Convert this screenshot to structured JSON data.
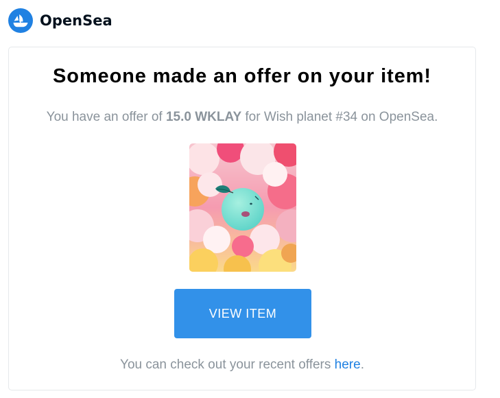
{
  "header": {
    "brand_name": "OpenSea",
    "logo_icon": "opensea-logo-icon",
    "logo_color": "#2081e2"
  },
  "card": {
    "title": "Someone made an offer on your item!",
    "subtitle_prefix": "You have an offer of ",
    "offer_amount": "15.0 WKLAY",
    "subtitle_middle": " for Wish planet #34 on OpenSea.",
    "image_icon": "nft-artwork-image",
    "button_label": "VIEW ITEM",
    "button_color": "#3291e9",
    "footer_prefix": "You can check out your recent offers ",
    "footer_link": "here",
    "footer_suffix": "."
  }
}
